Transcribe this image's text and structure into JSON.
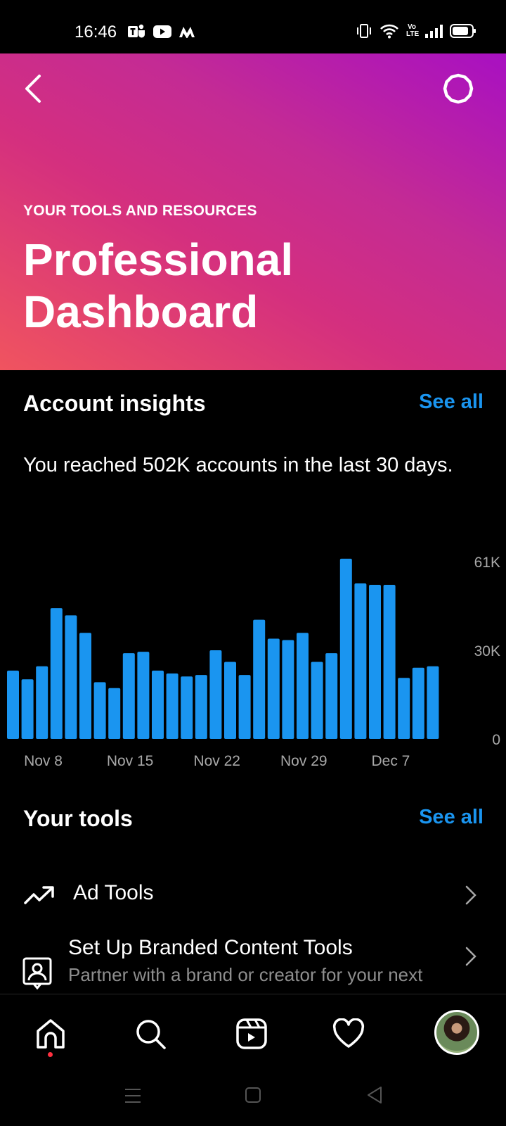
{
  "status_bar": {
    "time": "16:46",
    "app_icons": [
      "teams-icon",
      "youtube-icon",
      "myntra-icon"
    ],
    "system_icons": [
      "vibrate-icon",
      "wifi-icon",
      "volte-icon",
      "signal-icon",
      "battery-icon"
    ],
    "volte_text": "Vo LTE"
  },
  "header": {
    "kicker": "YOUR TOOLS AND RESOURCES",
    "title": "Professional Dashboard",
    "gradient": [
      "#f0545f",
      "#d42f7f",
      "#a810c2"
    ]
  },
  "insights": {
    "heading": "Account insights",
    "see_all": "See all",
    "reach_text": "You reached 502K accounts in the last 30 days."
  },
  "chart_data": {
    "type": "bar",
    "bar_color": "#1a95f0",
    "x_tick_labels": [
      "Nov 8",
      "Nov 15",
      "Nov 22",
      "Nov 29",
      "Dec 7"
    ],
    "y_tick_labels": [
      "61K",
      "30K",
      "0"
    ],
    "ylim": [
      0,
      61000
    ],
    "values": [
      23500,
      20500,
      25000,
      45000,
      42500,
      36500,
      19500,
      17500,
      29500,
      30000,
      23500,
      22500,
      21500,
      22000,
      30500,
      26500,
      22000,
      41000,
      34500,
      34000,
      36500,
      26500,
      29500,
      62000,
      53500,
      53000,
      53000,
      21000,
      24500,
      25000
    ]
  },
  "tools": {
    "heading": "Your tools",
    "see_all": "See all",
    "items": [
      {
        "label": "Ad Tools",
        "icon": "trending-up-icon"
      },
      {
        "label": "Set Up Branded Content Tools",
        "sub": "Partner with a brand or creator for your next",
        "icon": "branded-content-icon"
      }
    ]
  },
  "bottom_nav": {
    "items": [
      "home-icon",
      "search-icon",
      "reels-icon",
      "heart-icon",
      "profile-avatar"
    ],
    "notification_color": "#ff3040"
  },
  "system_nav": [
    "menu-icon",
    "home-square-icon",
    "back-triangle-icon"
  ]
}
